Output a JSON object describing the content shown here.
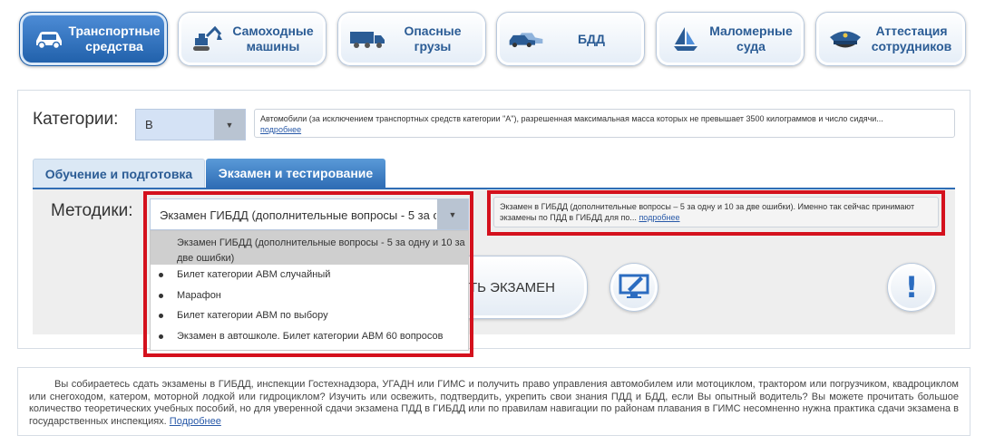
{
  "nav": {
    "items": [
      {
        "label": "Транспортные\nсредства",
        "icon": "car-icon",
        "active": true
      },
      {
        "label": "Самоходные\nмашины",
        "icon": "excavator-icon",
        "active": false
      },
      {
        "label": "Опасные\nгрузы",
        "icon": "truck-icon",
        "active": false
      },
      {
        "label": "БДД",
        "icon": "cars-icon",
        "active": false
      },
      {
        "label": "Маломерные\nсуда",
        "icon": "sailboat-icon",
        "active": false
      },
      {
        "label": "Аттестация\nсотрудников",
        "icon": "police-cap-icon",
        "active": false
      }
    ]
  },
  "category": {
    "label": "Категории:",
    "selected": "B",
    "description": "Автомобили (за исключением транспортных средств категории \"А\"), разрешенная максимальная масса которых не превышает 3500 килограммов и число сидячи...",
    "more_link": "подробнее"
  },
  "tabs": [
    {
      "label": "Обучение и подготовка",
      "active": false
    },
    {
      "label": "Экзамен и тестирование",
      "active": true
    }
  ],
  "methods": {
    "label": "Методики:",
    "selected": "Экзамен ГИБДД (дополнительные вопросы - 5 за одну и 10 за две ошибки)",
    "options": [
      {
        "label": "Экзамен ГИБДД (дополнительные вопросы - 5 за одну и 10 за две ошибки)",
        "selected": true
      },
      {
        "label": "Билет категории ABM случайный",
        "selected": false
      },
      {
        "label": "Марафон",
        "selected": false
      },
      {
        "label": "Билет категории ABM по выбору",
        "selected": false
      },
      {
        "label": "Экзамен в автошколе. Билет категории ABM 60 вопросов",
        "selected": false
      }
    ],
    "description": "Экзамен в ГИБДД (дополнительные вопросы – 5 за одну и 10 за две ошибки). Именно так сейчас принимают экзамены по ПДД в ГИБДД для по...",
    "more_link": "подробнее"
  },
  "start_button_label": "ТЬ ЭКЗАМЕН",
  "icons": {
    "monitor": "monitor-pen-icon",
    "info": "exclamation-icon"
  },
  "info_glyph": "!",
  "info": {
    "text": "Вы собираетесь сдать экзамены в ГИБДД, инспекции Гостехнадзора, УГАДН или ГИМС и получить право управления автомобилем или мотоциклом, трактором или погрузчиком, квадроциклом или снегоходом, катером, моторной лодкой или гидроциклом? Изучить или освежить, подтвердить, укрепить свои знания ПДД и БДД, если Вы опытный водитель? Вы можете прочитать большое количество теоретических учебных пособий, но для уверенной сдачи экзамена ПДД в ГИБДД или по правилам навигации по районам плавания в ГИМС несомненно нужна практика сдачи экзамена в государственных инспекциях.",
    "more_link": "Подробнее"
  },
  "colors": {
    "accent": "#2f6db5",
    "highlight": "#d4111d",
    "nav_text": "#2b5c95"
  }
}
